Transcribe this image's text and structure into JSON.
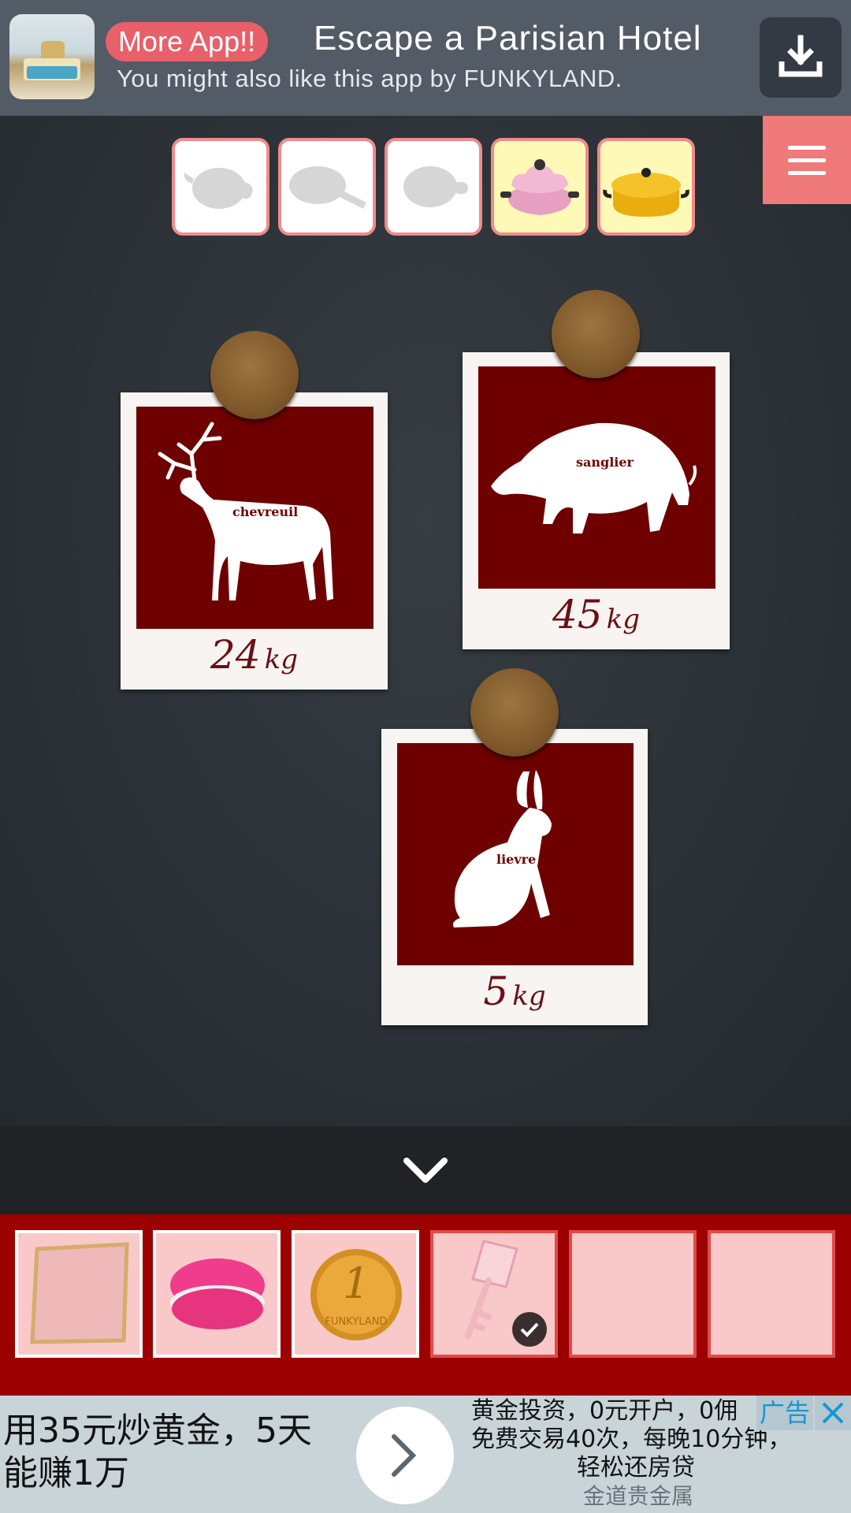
{
  "promo": {
    "badge": "More App!!",
    "title": "Escape a Parisian Hotel",
    "subtitle": "You might also like this app by FUNKYLAND.",
    "download_icon": "download-icon"
  },
  "menu": {
    "icon": "hamburger-menu-icon"
  },
  "item_tabs": [
    {
      "name": "teapot",
      "state": "silhouette"
    },
    {
      "name": "frying-pan",
      "state": "silhouette"
    },
    {
      "name": "pot",
      "state": "silhouette"
    },
    {
      "name": "pink-flower-pot",
      "state": "found"
    },
    {
      "name": "yellow-dutch-oven",
      "state": "found"
    }
  ],
  "photos": {
    "deer": {
      "label": "chevreuil",
      "weight": "24",
      "unit": "kg"
    },
    "boar": {
      "label": "sanglier",
      "weight": "45",
      "unit": "kg"
    },
    "hare": {
      "label": "lievre",
      "weight": "5",
      "unit": "kg"
    }
  },
  "collapse": {
    "icon": "chevron-down-icon"
  },
  "inventory": {
    "slots": [
      {
        "item": "gold-frame"
      },
      {
        "item": "pink-macaron"
      },
      {
        "item": "funkyland-coin",
        "coin_text": "1",
        "coin_brand": "FUNKYLAND"
      },
      {
        "item": "pink-key",
        "selected": true
      },
      {
        "item": ""
      },
      {
        "item": ""
      }
    ]
  },
  "ad": {
    "left_line1": "用35元炒黄金，5天",
    "left_line2": "能赚1万",
    "right_line1": "黄金投资，0元开户，0佣",
    "right_line2": "免费交易40次，每晚10分钟，",
    "right_line3": "轻松还房贷",
    "right_line4": "金道贵金属",
    "tag": "广告"
  },
  "colors": {
    "inventory_bg": "#9c0000",
    "accent_pink": "#f07a7a",
    "photo_red": "#6e0000"
  }
}
